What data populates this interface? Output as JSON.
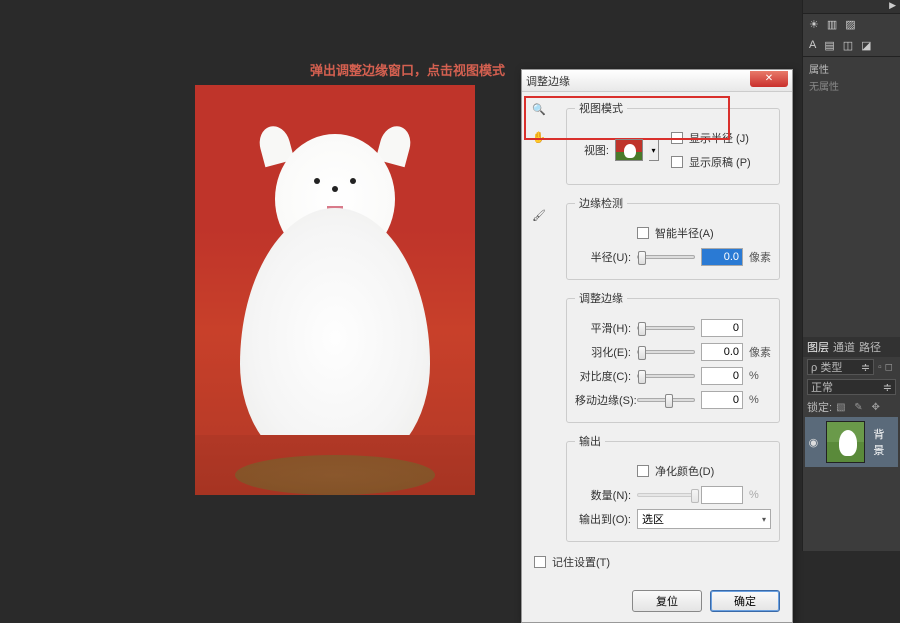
{
  "annotation": "弹出调整边缘窗口，点击视图模式",
  "dialog": {
    "title": "调整边缘",
    "groups": {
      "viewMode": {
        "legend": "视图模式",
        "viewLabel": "视图:",
        "showRadius": "显示半径 (J)",
        "showOriginal": "显示原稿 (P)"
      },
      "edgeDetect": {
        "legend": "边缘检测",
        "smartRadius": "智能半径(A)",
        "radiusLabel": "半径(U):",
        "radiusValue": "0.0",
        "radiusUnit": "像素"
      },
      "refineEdge": {
        "legend": "调整边缘",
        "smoothLabel": "平滑(H):",
        "smoothValue": "0",
        "featherLabel": "羽化(E):",
        "featherValue": "0.0",
        "featherUnit": "像素",
        "contrastLabel": "对比度(C):",
        "contrastValue": "0",
        "contrastUnit": "%",
        "shiftLabel": "移动边缘(S):",
        "shiftValue": "0",
        "shiftUnit": "%"
      },
      "output": {
        "legend": "输出",
        "purify": "净化颜色(D)",
        "amountLabel": "数量(N):",
        "amountUnit": "%",
        "outputToLabel": "输出到(O):",
        "outputToValue": "选区"
      }
    },
    "remember": "记住设置(T)",
    "buttons": {
      "reset": "复位",
      "ok": "确定"
    }
  },
  "rightPanel": {
    "properties": "属性",
    "noProperties": "无属性",
    "tabs": {
      "layers": "图层",
      "channels": "通道",
      "paths": "路径"
    },
    "kindLabel": "ρ 类型",
    "blendMode": "正常",
    "lockLabel": "锁定:",
    "layerName": "背景"
  }
}
